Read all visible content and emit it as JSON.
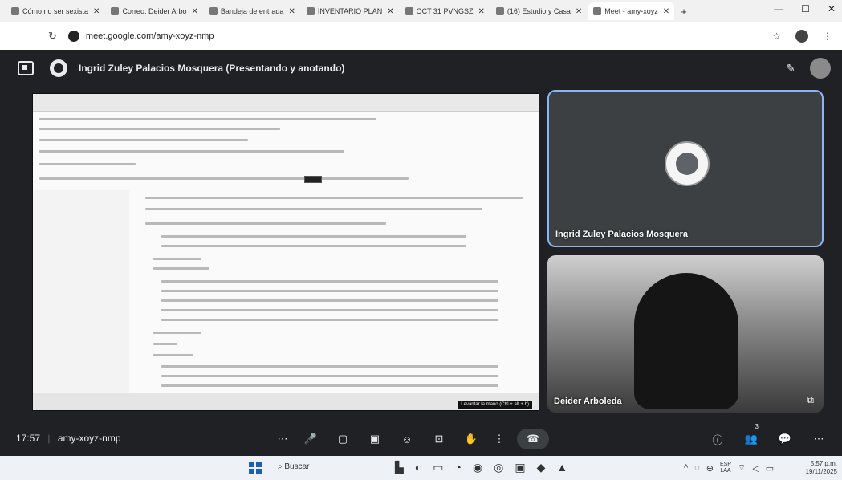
{
  "browser": {
    "tabs": [
      {
        "label": "Cómo no ser sexista"
      },
      {
        "label": "Correo: Deider Arbo"
      },
      {
        "label": "Bandeja de entrada"
      },
      {
        "label": "INVENTARIO PLAN"
      },
      {
        "label": "OCT 31 PVNGSZ"
      },
      {
        "label": "(16) Estudio y Casa"
      },
      {
        "label": "Meet - amy-xoyz"
      }
    ],
    "new_tab": "+",
    "window_controls": {
      "minimize": "—",
      "maximize": "☐",
      "close": "✕"
    },
    "address": {
      "reload": "↻",
      "url": "meet.google.com/amy-xoyz-nmp"
    },
    "toolbar": {
      "star": "☆",
      "menu": "⋮"
    }
  },
  "meet": {
    "presenter_title": "Ingrid Zuley Palacios Mosquera (Presentando y anotando)",
    "tiles": [
      {
        "name": "Ingrid Zuley Palacios Mosquera"
      },
      {
        "name": "Deider Arboleda"
      }
    ],
    "shared_tooltip": "Levantar la mano (Ctrl + alt + h)",
    "bottom": {
      "time": "17:57",
      "meeting_code": "amy-xoyz-nmp",
      "controls": {
        "more": "⋯",
        "mic": "🎤",
        "camera": "▢",
        "captions": "▣",
        "emoji": "☺",
        "present": "⊡",
        "hand": "✋",
        "options": "⋮",
        "hangup": "☎"
      },
      "right": {
        "info": "ⓘ",
        "people": "👥",
        "chat": "💬",
        "activities": "⋯"
      },
      "people_count": "3"
    }
  },
  "taskbar": {
    "search_label": "Buscar",
    "tray": {
      "lang_top": "ESP",
      "lang_bottom": "LAA"
    },
    "clock": {
      "time": "5:57 p.m.",
      "date": "19/11/2025"
    }
  },
  "colors": {
    "meet_bg": "#202124",
    "active_border": "#8ab4f8",
    "tab_strip": "#f1f1f1"
  }
}
